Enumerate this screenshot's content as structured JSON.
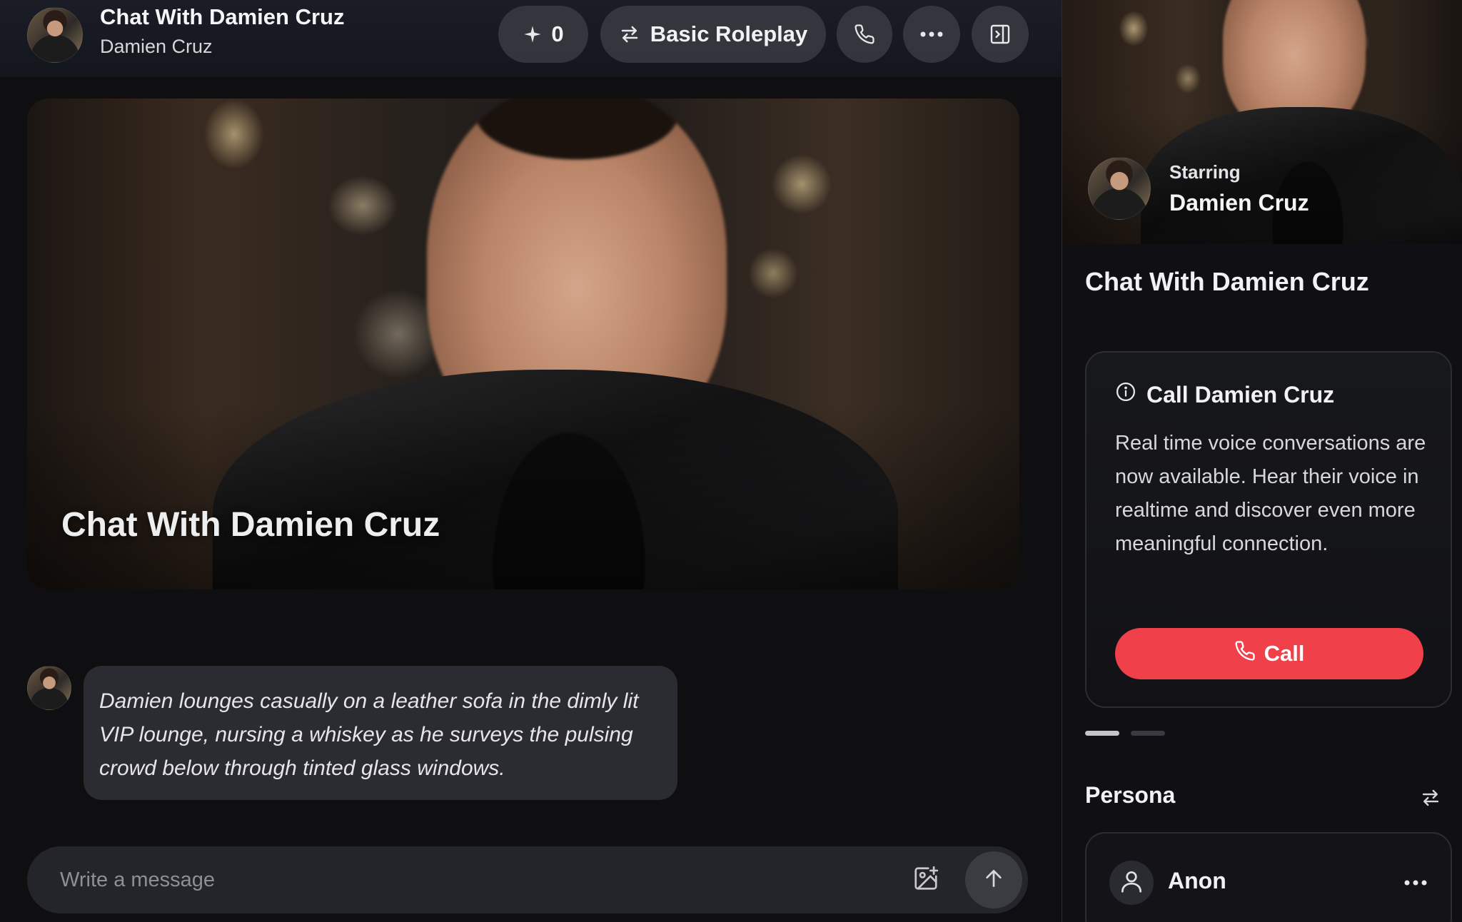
{
  "header": {
    "title": "Chat With Damien Cruz",
    "subtitle": "Damien Cruz",
    "stars_count": "0",
    "mode_label": "Basic Roleplay",
    "icons": {
      "stars": "sparkle-icon",
      "mode": "swap-arrows-icon",
      "phone": "phone-icon",
      "more": "more-horizontal-icon",
      "panel": "sidebar-panel-icon"
    }
  },
  "hero": {
    "title": "Chat With Damien Cruz"
  },
  "chat": {
    "messages": [
      {
        "author": "Damien Cruz",
        "text": "Damien lounges casually on a leather sofa in the dimly lit VIP lounge, nursing a whiskey as he surveys the pulsing crowd below through tinted glass windows."
      }
    ]
  },
  "composer": {
    "placeholder": "Write a message",
    "value": "",
    "icons": {
      "image": "image-add-icon",
      "send": "arrow-up-icon"
    }
  },
  "sidebar": {
    "banner": {
      "starring_label": "Starring",
      "name": "Damien Cruz"
    },
    "title": "Chat With Damien Cruz",
    "call_card": {
      "heading": "Call Damien Cruz",
      "body": "Real time voice conversations are now available. Hear their voice in realtime and discover even more meaningful connection.",
      "button_label": "Call",
      "icons": {
        "info": "info-circle-icon",
        "phone": "phone-icon"
      }
    },
    "carousel": {
      "total": 2,
      "active_index": 0
    },
    "persona": {
      "label": "Persona",
      "name": "Anon",
      "icons": {
        "switch": "swap-arrows-icon",
        "avatar": "user-icon",
        "more": "more-horizontal-icon"
      }
    }
  },
  "colors": {
    "background": "#0f0f12",
    "bubble": "#2b2c31",
    "accent_call": "#f0404a",
    "pill": "#363840"
  }
}
